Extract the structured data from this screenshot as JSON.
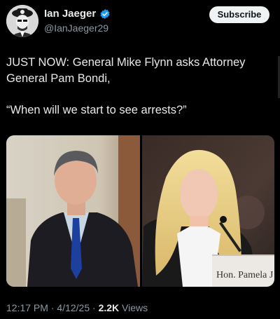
{
  "author": {
    "display_name": "Ian Jaeger",
    "handle": "@IanJaeger29",
    "verified_color": "#1d9bf0"
  },
  "actions": {
    "subscribe_label": "Subscribe"
  },
  "tweet": {
    "line1": "JUST NOW: General Mike Flynn asks Attorney General Pam Bondi,",
    "line2": "“When will we start to see arrests?”"
  },
  "media": {
    "nameplate_text": "Hon. Pamela J"
  },
  "meta": {
    "time": "12:17 PM",
    "sep1": " · ",
    "date": "4/12/25",
    "sep2": " · ",
    "views_count": "2.2K",
    "views_label": " Views"
  }
}
